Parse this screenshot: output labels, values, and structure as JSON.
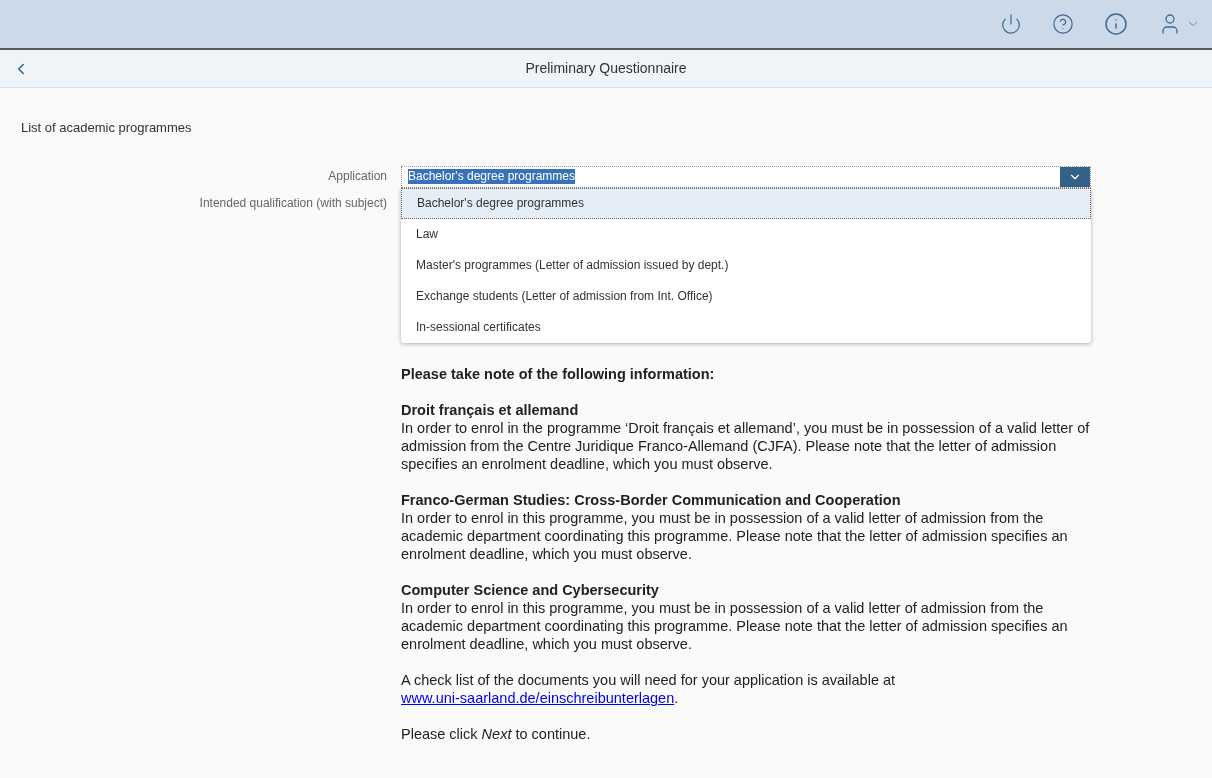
{
  "page_title": "Preliminary Questionnaire",
  "section_title": "List of academic programmes",
  "form": {
    "application_label": "Application",
    "application_value": "Bachelor's degree programmes",
    "expanded": true,
    "qualification_label": "Intended qualification (with subject)",
    "options": [
      {
        "label": "Bachelor's degree programmes",
        "selected": true
      },
      {
        "label": "Law",
        "selected": false
      },
      {
        "label": "Master's programmes (Letter of admission issued by dept.)",
        "selected": false
      },
      {
        "label": "Exchange students (Letter of admission from Int. Office)",
        "selected": false
      },
      {
        "label": "In-sessional certificates",
        "selected": false
      }
    ]
  },
  "info": {
    "heading": "Please take note of the following information:",
    "sections": [
      {
        "title": "Droit français et allemand",
        "body": "In order to enrol in the programme ‘Droit français et allemand’, you must be in possession of a valid letter of admission from the Centre Juridique Franco-Allemand (CJFA). Please note that the letter of admission specifies an enrolment deadline, which you must observe."
      },
      {
        "title": "Franco-German Studies: Cross-Border Communication and Cooperation",
        "body": "In order to enrol in this programme, you must be in possession of a valid letter of admission from the academic department coordinating this programme. Please note that the letter of admission specifies an enrolment deadline, which you must observe."
      },
      {
        "title": "Computer Science and Cybersecurity",
        "body": "In order to enrol in this programme, you must be in possession of a valid letter of admission from the academic department coordinating this programme. Please note that the letter of admission specifies an enrolment deadline, which you must observe."
      }
    ],
    "checklist_text": "A check list of the documents you will need for your application is available at",
    "checklist_link": "www.uni-saarland.de/einschreibunterlagen",
    "checklist_end": ".",
    "continue": "Please click *Next* to continue."
  }
}
